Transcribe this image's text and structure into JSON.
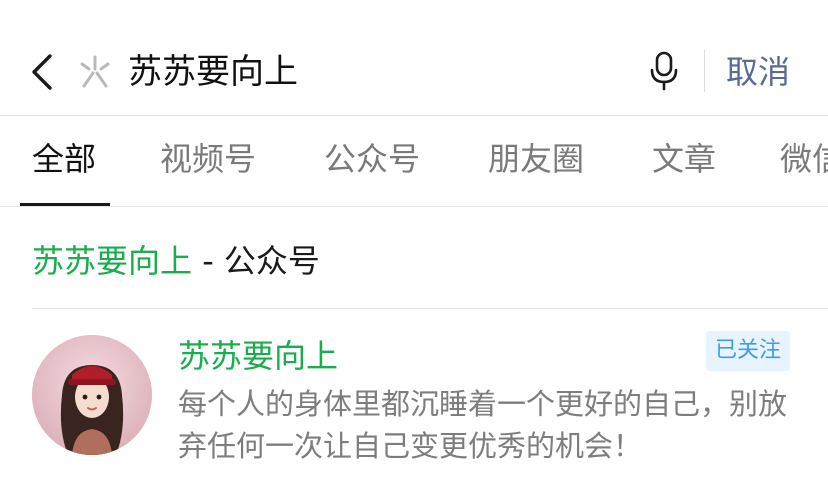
{
  "search": {
    "query": "苏苏要向上",
    "cancel_label": "取消"
  },
  "tabs": [
    {
      "label": "全部",
      "active": true
    },
    {
      "label": "视频号",
      "active": false
    },
    {
      "label": "公众号",
      "active": false
    },
    {
      "label": "文章",
      "active": false
    },
    {
      "label": "微信",
      "active": false
    }
  ],
  "section": {
    "highlight": "苏苏要向上",
    "suffix": " - 公众号"
  },
  "result": {
    "name": "苏苏要向上",
    "status_badge": "已关注",
    "description": "每个人的身体里都沉睡着一个更好的自己，别放弃任何一次让自己变更优秀的机会！"
  },
  "colors": {
    "highlight_green": "#19ad4d",
    "link_blue": "#576b95",
    "badge_blue": "#3f9ce9",
    "badge_bg": "#e7f4fd"
  },
  "icons": {
    "back": "chevron-left-icon",
    "search_logo": "search-logo-icon",
    "mic": "microphone-icon"
  }
}
